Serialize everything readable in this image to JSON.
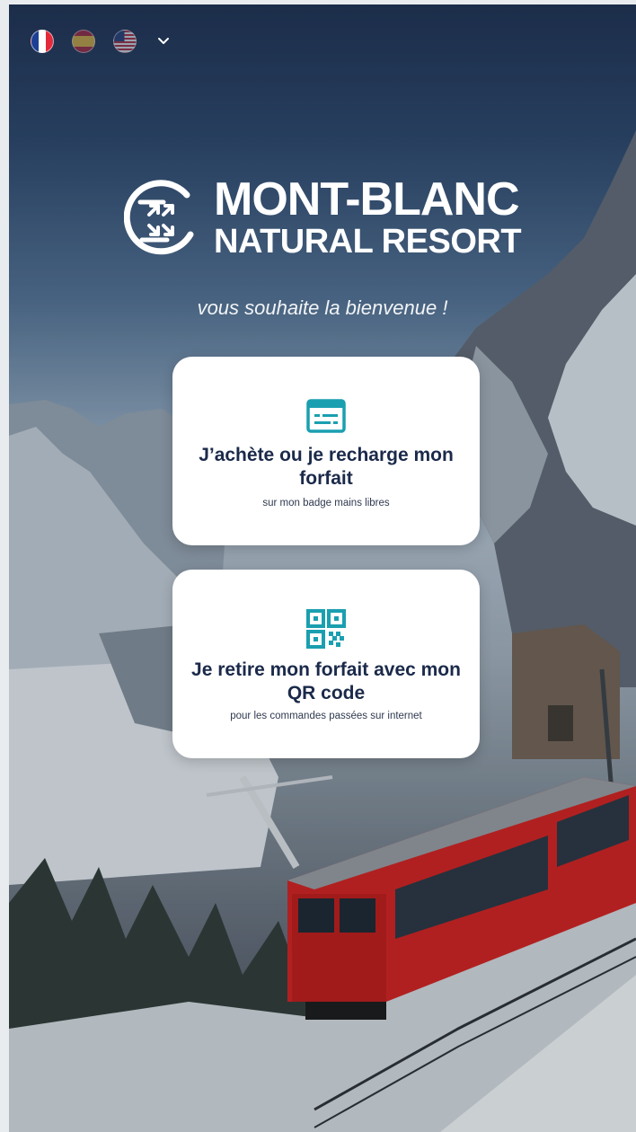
{
  "languages": [
    {
      "code": "fr",
      "icon": "flag-fr-icon",
      "active": true
    },
    {
      "code": "es",
      "icon": "flag-es-icon",
      "active": false
    },
    {
      "code": "us",
      "icon": "flag-us-icon",
      "active": false
    }
  ],
  "logo": {
    "line1": "MONT-BLANC",
    "line2": "NATURAL RESORT",
    "mark_icon": "resort-logo-icon"
  },
  "welcome": "vous souhaite la bienvenue !",
  "cards": {
    "recharge": {
      "icon": "badge-card-icon",
      "title": "J’achète ou je recharge mon forfait",
      "subtitle": "sur mon badge mains libres"
    },
    "qr": {
      "icon": "qr-code-icon",
      "title": "Je retire mon forfait avec mon QR code",
      "subtitle": "pour les commandes passées sur internet"
    }
  },
  "colors": {
    "accent": "#1a9fb0",
    "title": "#1b2a4a",
    "train": "#c8201f"
  }
}
